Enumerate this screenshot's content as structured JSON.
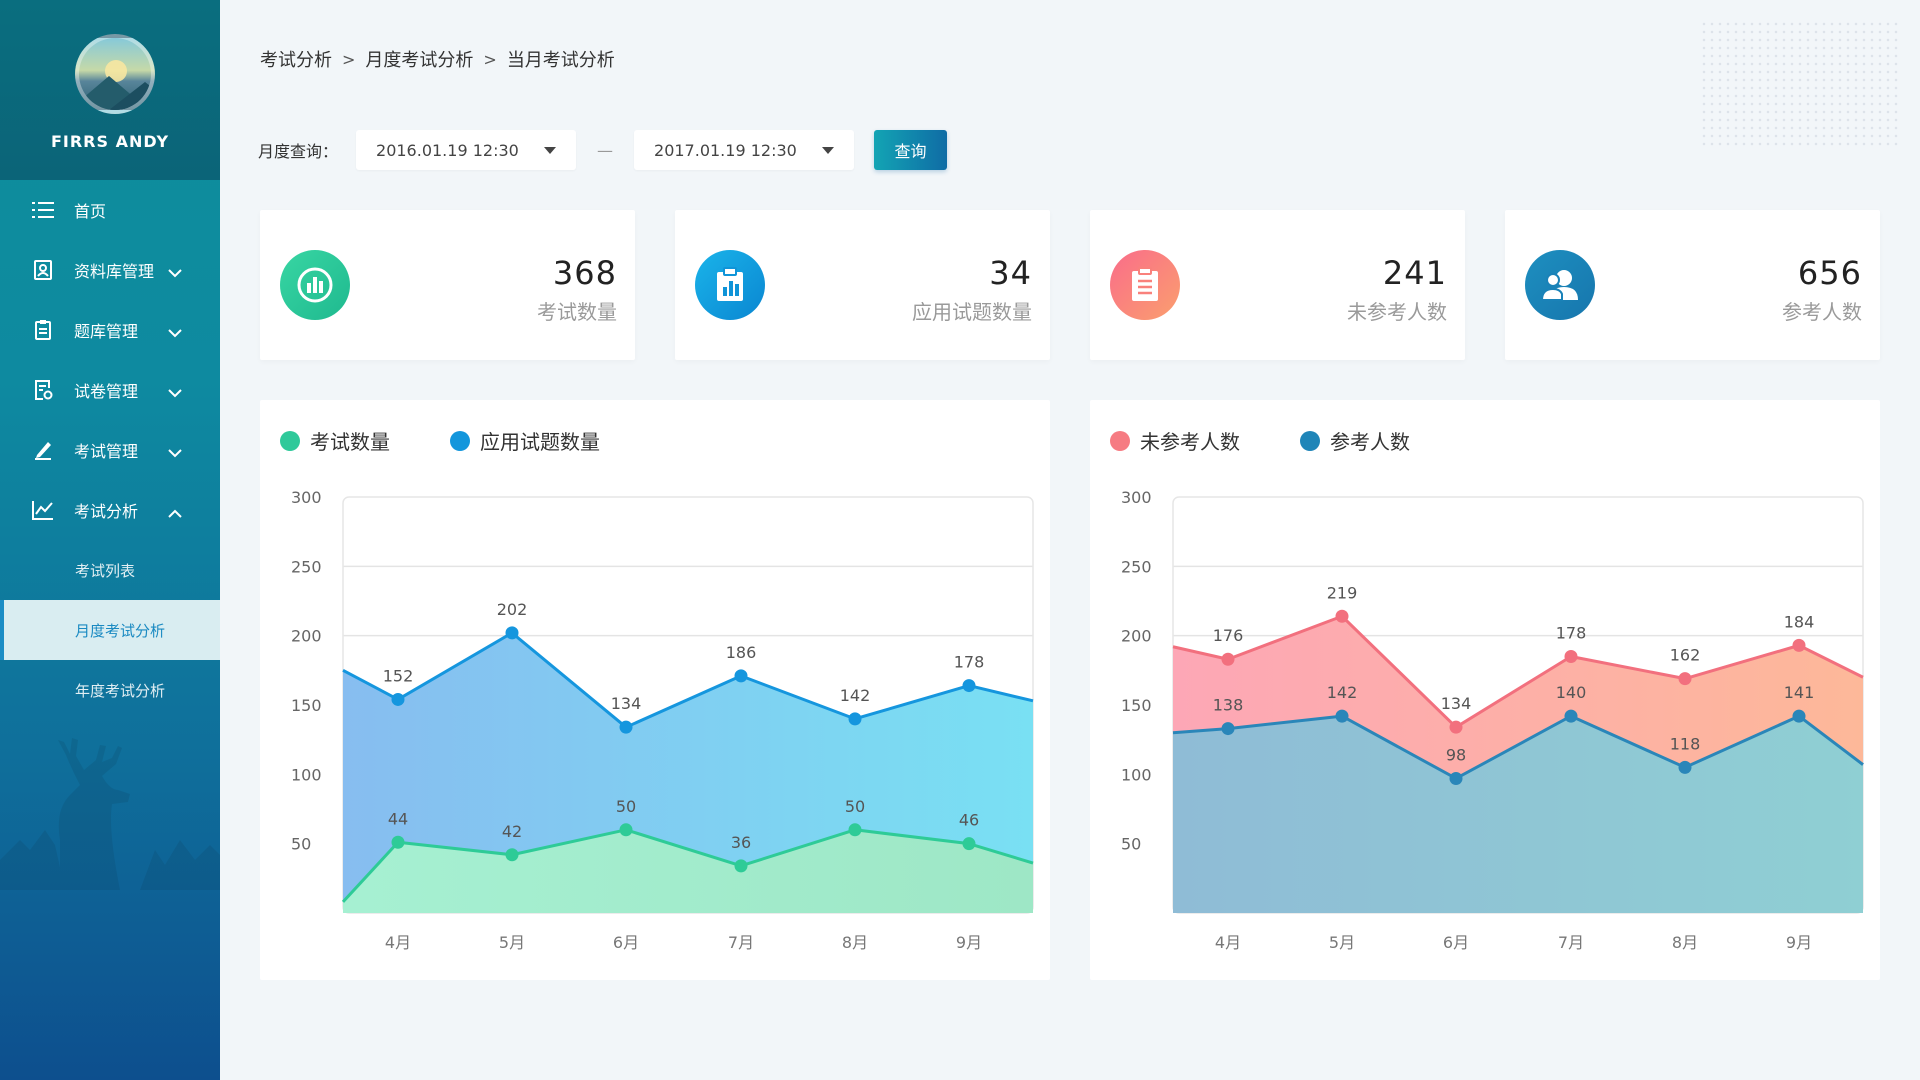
{
  "sidebar": {
    "username": "FIRRS ANDY",
    "menu": [
      {
        "label": "首页",
        "icon": "list-icon"
      },
      {
        "label": "资料库管理",
        "icon": "profile-card-icon"
      },
      {
        "label": "题库管理",
        "icon": "clipboard-icon"
      },
      {
        "label": "试卷管理",
        "icon": "paper-settings-icon"
      },
      {
        "label": "考试管理",
        "icon": "pen-icon"
      },
      {
        "label": "考试分析",
        "icon": "line-chart-icon"
      }
    ],
    "submenu": [
      {
        "label": "考试列表"
      },
      {
        "label": "月度考试分析",
        "active": true
      },
      {
        "label": "年度考试分析"
      }
    ]
  },
  "breadcrumb": [
    "考试分析",
    "月度考试分析",
    "当月考试分析"
  ],
  "query": {
    "label": "月度查询：",
    "start": "2016.01.19 12:30",
    "end": "2017.01.19 12:30",
    "separator": "—",
    "button": "查询"
  },
  "stats": [
    {
      "value": "368",
      "label": "考试数量",
      "icon": "bar-chart-icon",
      "color": "#2fc99a"
    },
    {
      "value": "34",
      "label": "应用试题数量",
      "icon": "clipboard-chart-icon",
      "color": "#1396dc"
    },
    {
      "value": "241",
      "label": "未参考人数",
      "icon": "document-list-icon",
      "color": "#f67b82"
    },
    {
      "value": "656",
      "label": "参考人数",
      "icon": "users-icon",
      "color": "#1f85b8"
    }
  ],
  "chart_data": [
    {
      "type": "area",
      "legend_placement": "top-left",
      "categories": [
        "4月",
        "5月",
        "6月",
        "7月",
        "8月",
        "9月"
      ],
      "ylim": [
        0,
        300
      ],
      "yticks": [
        50,
        100,
        150,
        200,
        250,
        300
      ],
      "grid": true,
      "series": [
        {
          "name": "考试数量",
          "values": [
            44,
            42,
            50,
            36,
            50,
            46
          ],
          "plotted": [
            51,
            42,
            60,
            34,
            60,
            50
          ],
          "left_edge": 8,
          "right_edge": 36,
          "color": "#2fc99a"
        },
        {
          "name": "应用试题数量",
          "values": [
            152,
            202,
            134,
            186,
            142,
            178
          ],
          "plotted": [
            154,
            202,
            134,
            171,
            140,
            164
          ],
          "left_edge": 175,
          "right_edge": 153,
          "color": "#1396dc"
        }
      ]
    },
    {
      "type": "area",
      "legend_placement": "top-left",
      "categories": [
        "4月",
        "5月",
        "6月",
        "7月",
        "8月",
        "9月"
      ],
      "ylim": [
        0,
        300
      ],
      "yticks": [
        50,
        100,
        150,
        200,
        250,
        300
      ],
      "grid": true,
      "series": [
        {
          "name": "未参考人数",
          "values": [
            176,
            219,
            134,
            178,
            162,
            184
          ],
          "plotted": [
            183,
            214,
            134,
            185,
            169,
            193
          ],
          "left_edge": 192,
          "right_edge": 170,
          "color": "#f67b82"
        },
        {
          "name": "参考人数",
          "values": [
            138,
            142,
            98,
            140,
            118,
            141
          ],
          "plotted": [
            133,
            142,
            97,
            142,
            105,
            142
          ],
          "left_edge": 130,
          "right_edge": 107,
          "color": "#1f85b8"
        }
      ]
    }
  ]
}
